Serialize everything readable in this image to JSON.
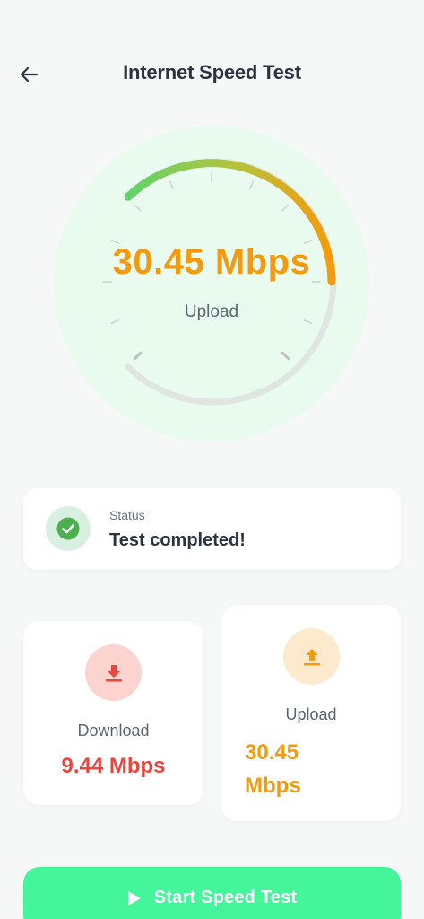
{
  "header": {
    "title": "Internet Speed Test",
    "back_icon": "arrow-left-icon"
  },
  "gauge": {
    "value_text": "30.45 Mbps",
    "mode_label": "Upload",
    "progress": 0.5,
    "colors": {
      "start": "#5fd36a",
      "end": "#f59a0c",
      "track": "#dfe6e2",
      "background": "#e9fbef"
    }
  },
  "status": {
    "caption": "Status",
    "text": "Test completed!",
    "icon": "check-circle-icon",
    "color": "#4caf50"
  },
  "download": {
    "label": "Download",
    "value": "9.44 Mbps",
    "icon": "download-icon",
    "color": "#e8453c"
  },
  "upload": {
    "label": "Upload",
    "value": "30.45 Mbps",
    "icon": "upload-icon",
    "color": "#f59a0c"
  },
  "start_button": {
    "label": "Start Speed Test",
    "icon": "play-icon",
    "color": "#44f59a"
  }
}
